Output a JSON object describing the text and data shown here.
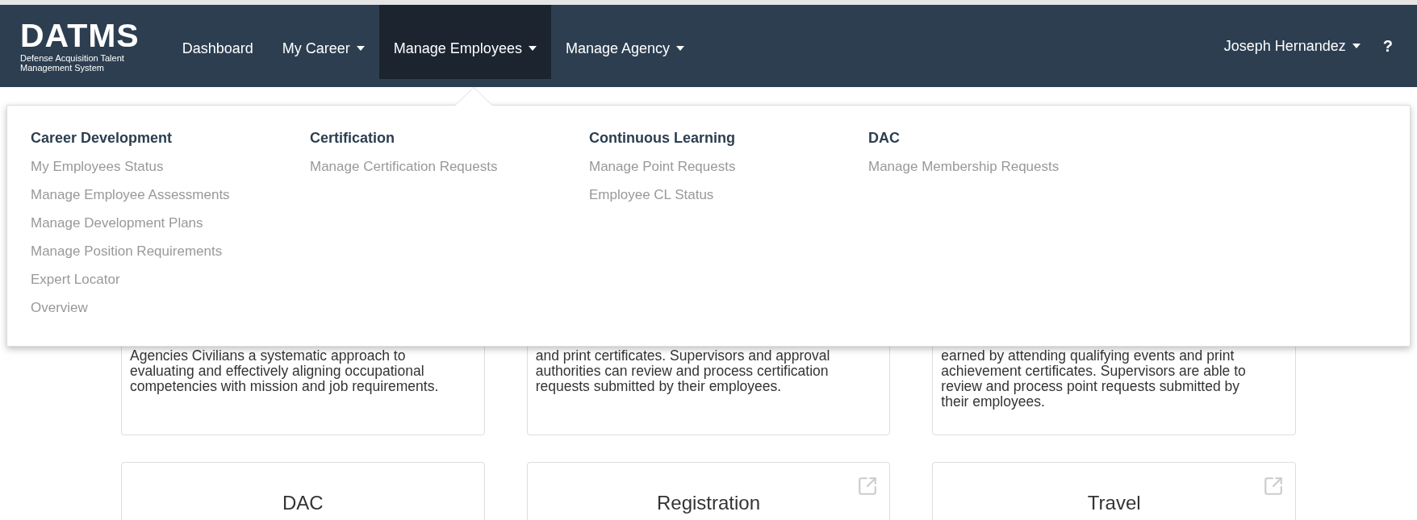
{
  "brand": {
    "title": "DATMS",
    "subtitle_lines": [
      "Defense Acquisition Talent",
      "Management System"
    ]
  },
  "nav": {
    "items": [
      {
        "label": "Dashboard",
        "dropdown": false,
        "selected": false
      },
      {
        "label": "My Career",
        "dropdown": true,
        "selected": false
      },
      {
        "label": "Manage Employees",
        "dropdown": true,
        "selected": true
      },
      {
        "label": "Manage Agency",
        "dropdown": true,
        "selected": false
      }
    ],
    "user": "Joseph Hernandez",
    "help": "?"
  },
  "menu": {
    "columns": [
      {
        "heading": "Career Development",
        "links": [
          "My Employees Status",
          "Manage Employee Assessments",
          "Manage Development Plans",
          "Manage Position Requirements",
          "Expert Locator",
          "Overview"
        ]
      },
      {
        "heading": "Certification",
        "links": [
          "Manage Certification Requests"
        ]
      },
      {
        "heading": "Continuous Learning",
        "links": [
          "Manage Point Requests",
          "Employee CL Status"
        ]
      },
      {
        "heading": "DAC",
        "links": [
          "Manage Membership Requests"
        ]
      }
    ]
  },
  "cards_top": [
    {
      "lines": [
        "Agencies Civilians a systematic approach to",
        "evaluating and effectively aligning occupational",
        "competencies with mission and job requirements."
      ]
    },
    {
      "lines": [
        "and print certificates. Supervisors and approval",
        "authorities can review and process certification",
        "requests submitted by their employees."
      ]
    },
    {
      "lines": [
        "earned by attending qualifying events and print",
        "achievement certificates. Supervisors are able to",
        "review and process point requests submitted by",
        "their employees."
      ]
    }
  ],
  "cards_bottom": [
    {
      "title": "DAC",
      "external": false
    },
    {
      "title": "Registration",
      "external": true
    },
    {
      "title": "Travel",
      "external": true
    }
  ]
}
